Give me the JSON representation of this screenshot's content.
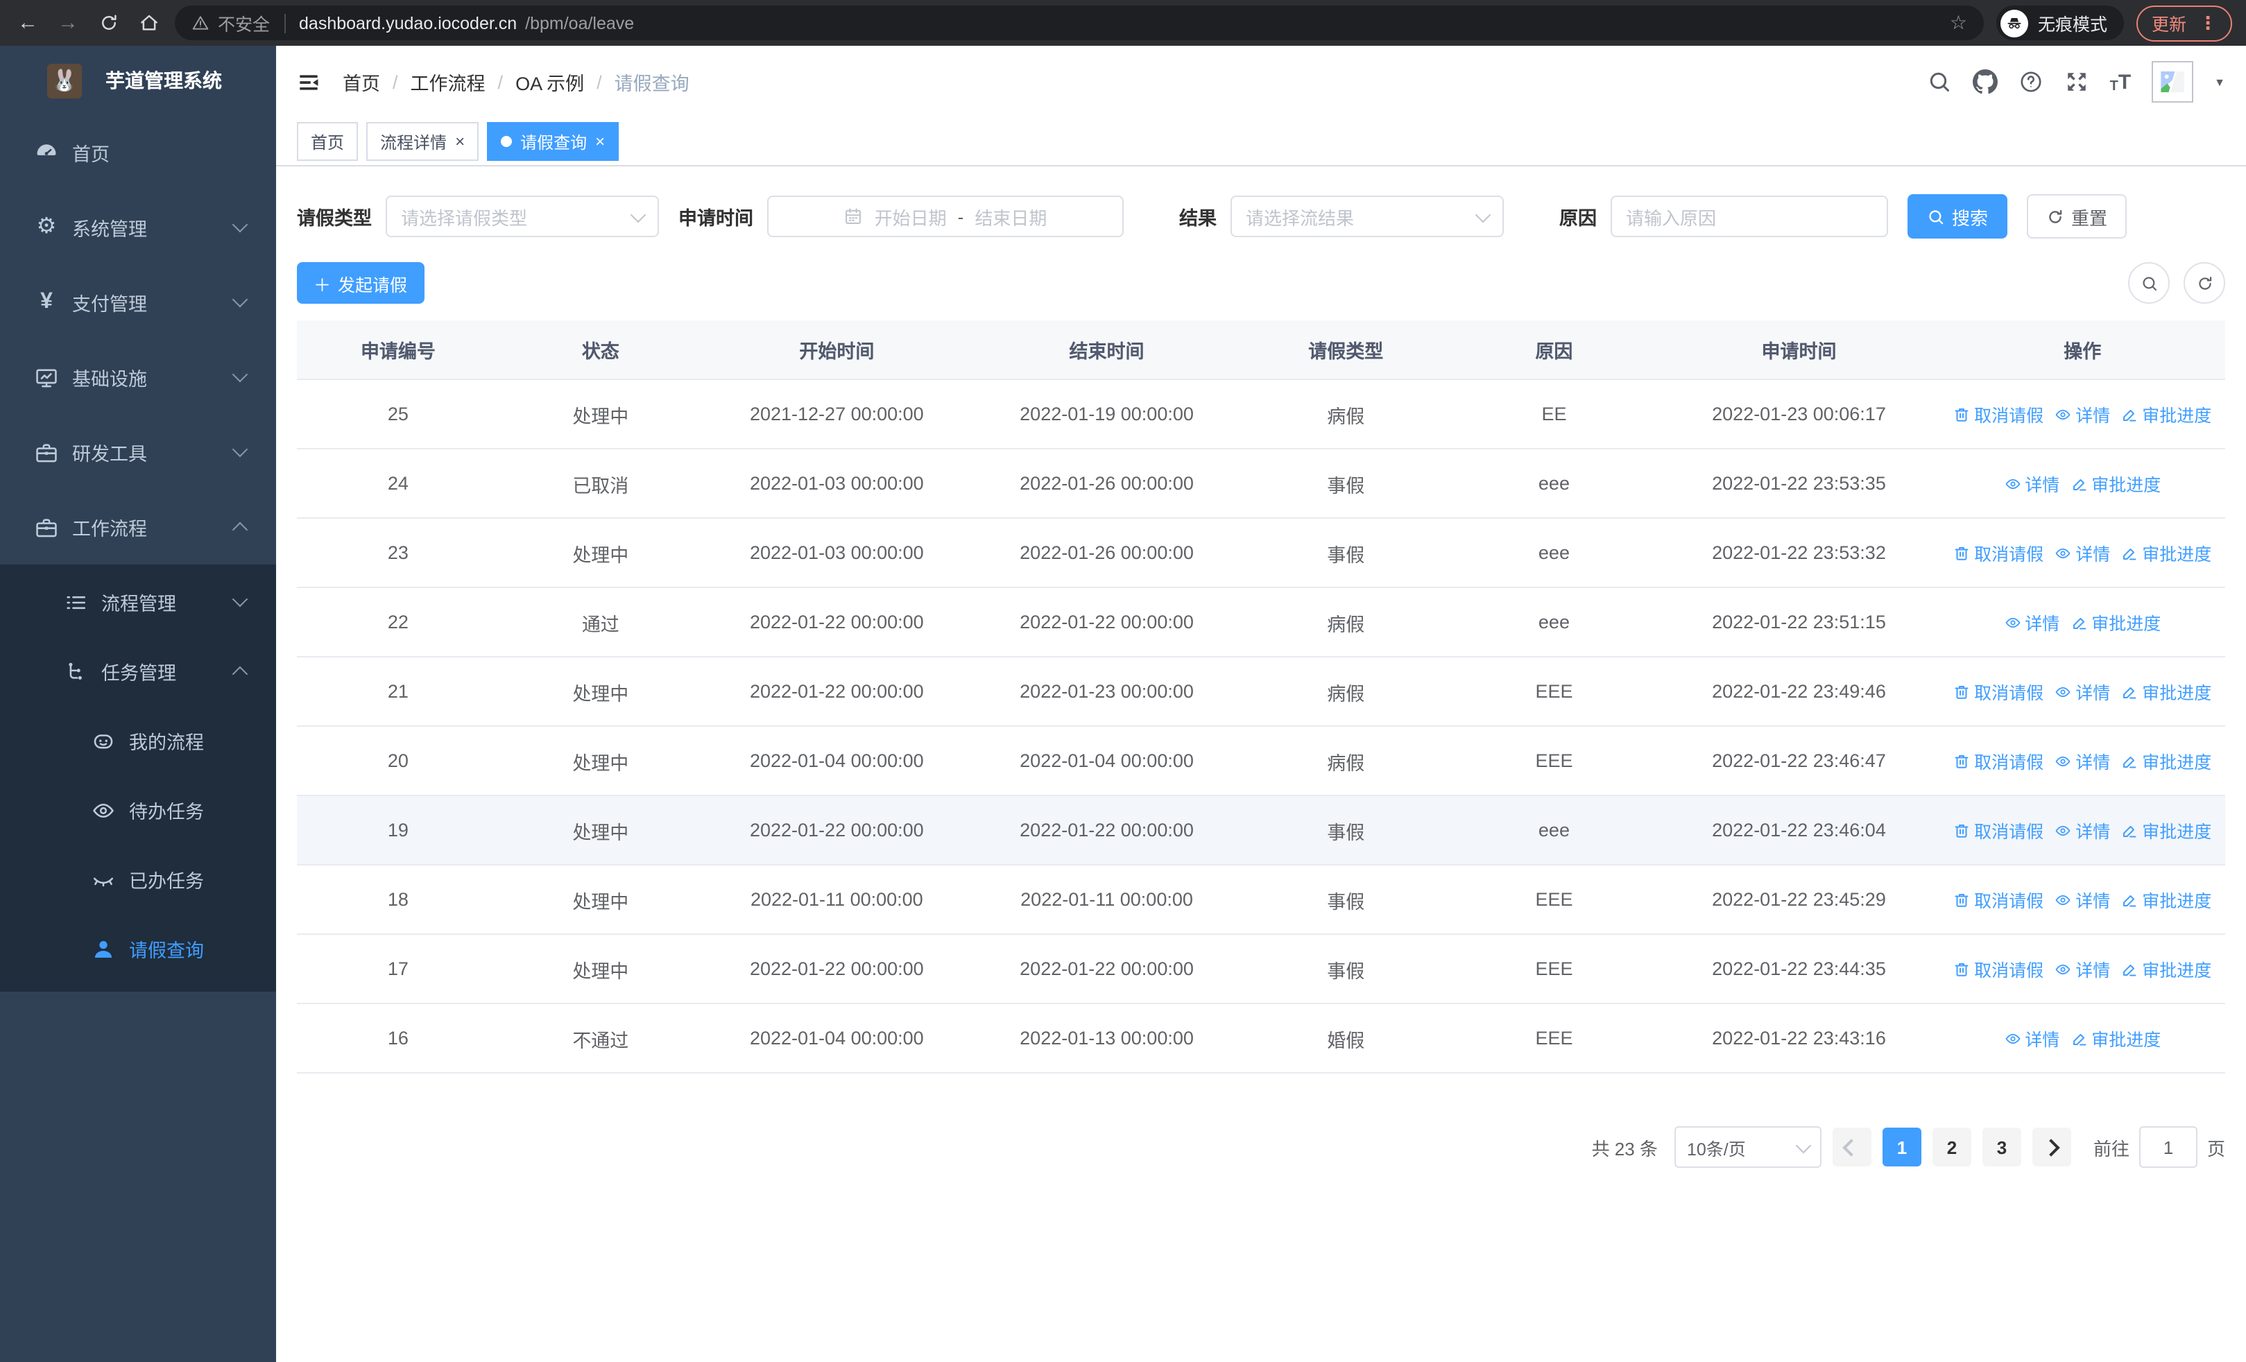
{
  "colors": {
    "accent": "#409eff",
    "sidebar_bg": "#304156",
    "submenu_bg": "#1f2d3d",
    "update_accent": "#f08a7e"
  },
  "browser": {
    "security_label": "不安全",
    "url_host": "dashboard.yudao.iocoder.cn",
    "url_path": "/bpm/oa/leave",
    "incognito_label": "无痕模式",
    "update_label": "更新"
  },
  "sidebar": {
    "title": "芋道管理系统",
    "items": [
      {
        "key": "home",
        "label": "首页",
        "icon": "dashboard-icon",
        "level": 1,
        "expandable": false,
        "expanded": false,
        "in_submenu": false,
        "active": false
      },
      {
        "key": "system",
        "label": "系统管理",
        "icon": "gear-icon",
        "level": 1,
        "expandable": true,
        "expanded": false,
        "in_submenu": false,
        "active": false
      },
      {
        "key": "payment",
        "label": "支付管理",
        "icon": "yen-icon",
        "level": 1,
        "expandable": true,
        "expanded": false,
        "in_submenu": false,
        "active": false
      },
      {
        "key": "infrastructure",
        "label": "基础设施",
        "icon": "monitor-icon",
        "level": 1,
        "expandable": true,
        "expanded": false,
        "in_submenu": false,
        "active": false
      },
      {
        "key": "dev-tools",
        "label": "研发工具",
        "icon": "briefcase-icon",
        "level": 1,
        "expandable": true,
        "expanded": false,
        "in_submenu": false,
        "active": false
      },
      {
        "key": "workflow",
        "label": "工作流程",
        "icon": "briefcase-icon",
        "level": 1,
        "expandable": true,
        "expanded": true,
        "in_submenu": false,
        "active": false
      },
      {
        "key": "process-mgmt",
        "label": "流程管理",
        "icon": "list-icon",
        "level": 2,
        "expandable": true,
        "expanded": false,
        "in_submenu": true,
        "active": false
      },
      {
        "key": "task-mgmt",
        "label": "任务管理",
        "icon": "flow-icon",
        "level": 2,
        "expandable": true,
        "expanded": true,
        "in_submenu": true,
        "active": false
      },
      {
        "key": "my-process",
        "label": "我的流程",
        "icon": "robot-icon",
        "level": 3,
        "expandable": false,
        "expanded": false,
        "in_submenu": true,
        "active": false
      },
      {
        "key": "todo-tasks",
        "label": "待办任务",
        "icon": "eye-icon",
        "level": 3,
        "expandable": false,
        "expanded": false,
        "in_submenu": true,
        "active": false
      },
      {
        "key": "done-tasks",
        "label": "已办任务",
        "icon": "eye-closed-icon",
        "level": 3,
        "expandable": false,
        "expanded": false,
        "in_submenu": true,
        "active": false
      },
      {
        "key": "leave-query",
        "label": "请假查询",
        "icon": "user-icon",
        "level": 3,
        "expandable": false,
        "expanded": false,
        "in_submenu": true,
        "active": true
      }
    ]
  },
  "breadcrumb": [
    "首页",
    "工作流程",
    "OA 示例",
    "请假查询"
  ],
  "tabs": [
    {
      "key": "home",
      "label": "首页",
      "closable": false,
      "active": false
    },
    {
      "key": "process-detail",
      "label": "流程详情",
      "closable": true,
      "active": false
    },
    {
      "key": "leave-query",
      "label": "请假查询",
      "closable": true,
      "active": true
    }
  ],
  "filters": {
    "leave_type_label": "请假类型",
    "leave_type_placeholder": "请选择请假类型",
    "apply_time_label": "申请时间",
    "start_date_placeholder": "开始日期",
    "date_separator": "-",
    "end_date_placeholder": "结束日期",
    "result_label": "结果",
    "result_placeholder": "请选择流结果",
    "reason_label": "原因",
    "reason_placeholder": "请输入原因",
    "search_label": "搜索",
    "reset_label": "重置"
  },
  "toolbar": {
    "create_label": "发起请假"
  },
  "table": {
    "headers": [
      "申请编号",
      "状态",
      "开始时间",
      "结束时间",
      "请假类型",
      "原因",
      "申请时间",
      "操作"
    ],
    "action_labels": {
      "cancel": "取消请假",
      "detail": "详情",
      "progress": "审批进度"
    },
    "rows": [
      {
        "id": "25",
        "status": "处理中",
        "start": "2021-12-27 00:00:00",
        "end": "2022-01-19 00:00:00",
        "type": "病假",
        "reason": "EE",
        "apply_time": "2022-01-23 00:06:17",
        "actions": [
          "cancel",
          "detail",
          "progress"
        ],
        "highlight": false
      },
      {
        "id": "24",
        "status": "已取消",
        "start": "2022-01-03 00:00:00",
        "end": "2022-01-26 00:00:00",
        "type": "事假",
        "reason": "eee",
        "apply_time": "2022-01-22 23:53:35",
        "actions": [
          "detail",
          "progress"
        ],
        "highlight": false
      },
      {
        "id": "23",
        "status": "处理中",
        "start": "2022-01-03 00:00:00",
        "end": "2022-01-26 00:00:00",
        "type": "事假",
        "reason": "eee",
        "apply_time": "2022-01-22 23:53:32",
        "actions": [
          "cancel",
          "detail",
          "progress"
        ],
        "highlight": false
      },
      {
        "id": "22",
        "status": "通过",
        "start": "2022-01-22 00:00:00",
        "end": "2022-01-22 00:00:00",
        "type": "病假",
        "reason": "eee",
        "apply_time": "2022-01-22 23:51:15",
        "actions": [
          "detail",
          "progress"
        ],
        "highlight": false
      },
      {
        "id": "21",
        "status": "处理中",
        "start": "2022-01-22 00:00:00",
        "end": "2022-01-23 00:00:00",
        "type": "病假",
        "reason": "EEE",
        "apply_time": "2022-01-22 23:49:46",
        "actions": [
          "cancel",
          "detail",
          "progress"
        ],
        "highlight": false
      },
      {
        "id": "20",
        "status": "处理中",
        "start": "2022-01-04 00:00:00",
        "end": "2022-01-04 00:00:00",
        "type": "病假",
        "reason": "EEE",
        "apply_time": "2022-01-22 23:46:47",
        "actions": [
          "cancel",
          "detail",
          "progress"
        ],
        "highlight": false
      },
      {
        "id": "19",
        "status": "处理中",
        "start": "2022-01-22 00:00:00",
        "end": "2022-01-22 00:00:00",
        "type": "事假",
        "reason": "eee",
        "apply_time": "2022-01-22 23:46:04",
        "actions": [
          "cancel",
          "detail",
          "progress"
        ],
        "highlight": true
      },
      {
        "id": "18",
        "status": "处理中",
        "start": "2022-01-11 00:00:00",
        "end": "2022-01-11 00:00:00",
        "type": "事假",
        "reason": "EEE",
        "apply_time": "2022-01-22 23:45:29",
        "actions": [
          "cancel",
          "detail",
          "progress"
        ],
        "highlight": false
      },
      {
        "id": "17",
        "status": "处理中",
        "start": "2022-01-22 00:00:00",
        "end": "2022-01-22 00:00:00",
        "type": "事假",
        "reason": "EEE",
        "apply_time": "2022-01-22 23:44:35",
        "actions": [
          "cancel",
          "detail",
          "progress"
        ],
        "highlight": false
      },
      {
        "id": "16",
        "status": "不通过",
        "start": "2022-01-04 00:00:00",
        "end": "2022-01-13 00:00:00",
        "type": "婚假",
        "reason": "EEE",
        "apply_time": "2022-01-22 23:43:16",
        "actions": [
          "detail",
          "progress"
        ],
        "highlight": false
      }
    ]
  },
  "pagination": {
    "total_label": "共 23 条",
    "page_size": "10条/页",
    "pages": [
      "1",
      "2",
      "3"
    ],
    "active_page": "1",
    "goto_label": "前往",
    "goto_value": "1",
    "page_suffix": "页"
  }
}
